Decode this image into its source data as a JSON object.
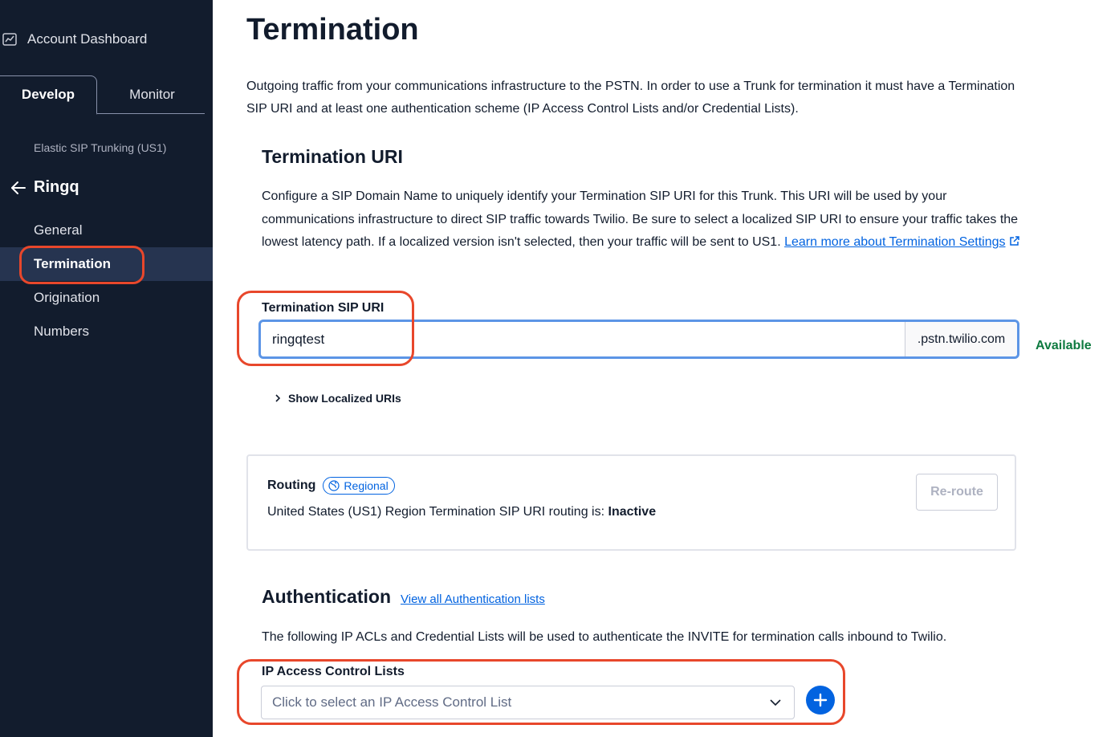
{
  "sidebar": {
    "account_dashboard": "Account Dashboard",
    "tabs": {
      "develop": "Develop",
      "monitor": "Monitor"
    },
    "product": "Elastic SIP Trunking (US1)",
    "back_label": "Ringq",
    "items": [
      {
        "label": "General"
      },
      {
        "label": "Termination"
      },
      {
        "label": "Origination"
      },
      {
        "label": "Numbers"
      }
    ]
  },
  "main": {
    "title": "Termination",
    "intro": "Outgoing traffic from your communications infrastructure to the PSTN. In order to use a Trunk for termination it must have a Termination SIP URI and at least one authentication scheme (IP Access Control Lists and/or Credential Lists).",
    "uri_section": {
      "heading": "Termination URI",
      "description": "Configure a SIP Domain Name to uniquely identify your Termination SIP URI for this Trunk. This URI will be used by your communications infrastructure to direct SIP traffic towards Twilio. Be sure to select a localized SIP URI to ensure your traffic takes the lowest latency path. If a localized version isn't selected, then your traffic will be sent to US1.",
      "learn_more_link": "Learn more about Termination Settings"
    },
    "sip_uri": {
      "label": "Termination SIP URI",
      "value": "ringqtest",
      "suffix": ".pstn.twilio.com",
      "status": "Available"
    },
    "show_localized": "Show Localized URIs",
    "routing": {
      "title": "Routing",
      "badge": "Regional",
      "text_prefix": "United States (US1) Region Termination SIP URI routing is:",
      "status": "Inactive",
      "reroute_button": "Re-route"
    },
    "authentication": {
      "heading": "Authentication",
      "link": "View all Authentication lists",
      "description": "The following IP ACLs and Credential Lists will be used to authenticate the INVITE for termination calls inbound to Twilio.",
      "ip_acl_label": "IP Access Control Lists",
      "ip_acl_placeholder": "Click to select an IP Access Control List"
    }
  },
  "colors": {
    "sidebar_bg": "#121c2d",
    "accent": "#0263e0",
    "highlight": "#e8472b",
    "available": "#0d7a3f"
  }
}
